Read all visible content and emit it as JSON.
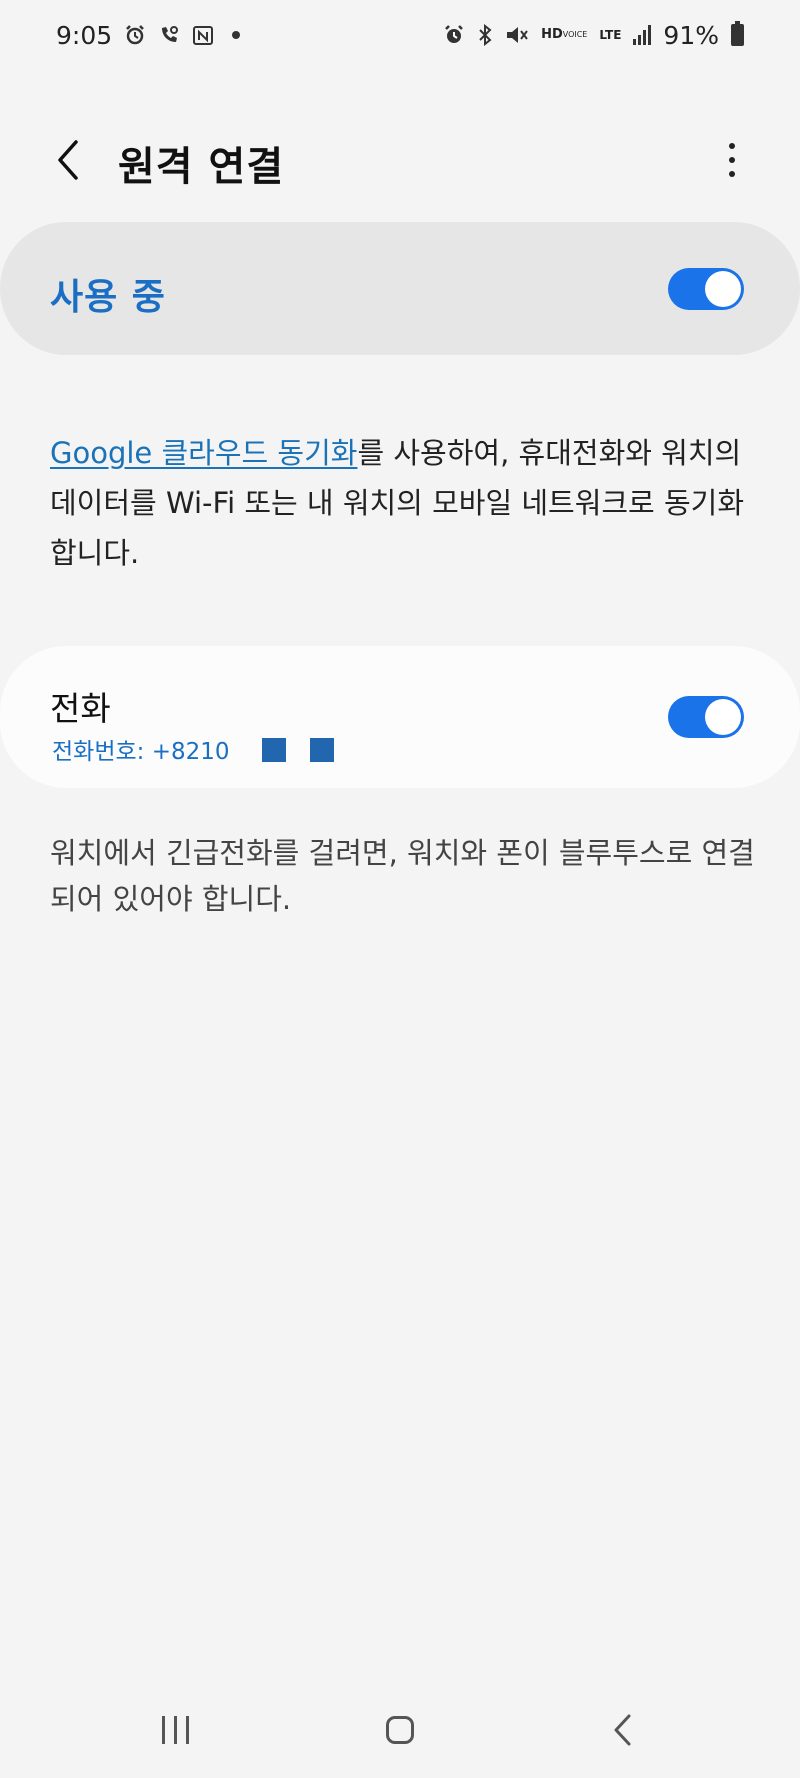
{
  "status_bar": {
    "time": "9:05",
    "left_icons": [
      "alarm-icon",
      "phone-sync-icon",
      "notification-n-icon"
    ],
    "right_icons": [
      "alarm-icon",
      "bluetooth-icon",
      "mute-icon",
      "hd-voice-icon",
      "lte-icon",
      "signal-icon",
      "battery-icon"
    ],
    "hd_label": "HD",
    "voice_label": "VOICE",
    "lte_label": "LTE",
    "battery_text": "91%"
  },
  "header": {
    "title": "원격 연결",
    "back_icon": "chevron-left-icon",
    "more_icon": "more-vertical-icon"
  },
  "master_switch": {
    "label": "사용 중",
    "enabled": true
  },
  "description": {
    "link_text": "Google 클라우드 동기화",
    "text": "를 사용하여, 휴대전화와 워치의 데이터를 Wi-Fi 또는 내 워치의 모바일 네트워크로 동기화합니다."
  },
  "phone_setting": {
    "title": "전화",
    "subtitle": "전화번호: +8210",
    "enabled": true
  },
  "note": "워치에서 긴급전화를 걸려면, 워치와 폰이 블루투스로 연결되어 있어야 합니다.",
  "nav_bar": {
    "icons": [
      "recent-apps-icon",
      "home-icon",
      "back-icon"
    ]
  },
  "colors": {
    "accent": "#1a73e8",
    "label_blue": "#1a6fc4",
    "background": "#f4f4f4"
  }
}
